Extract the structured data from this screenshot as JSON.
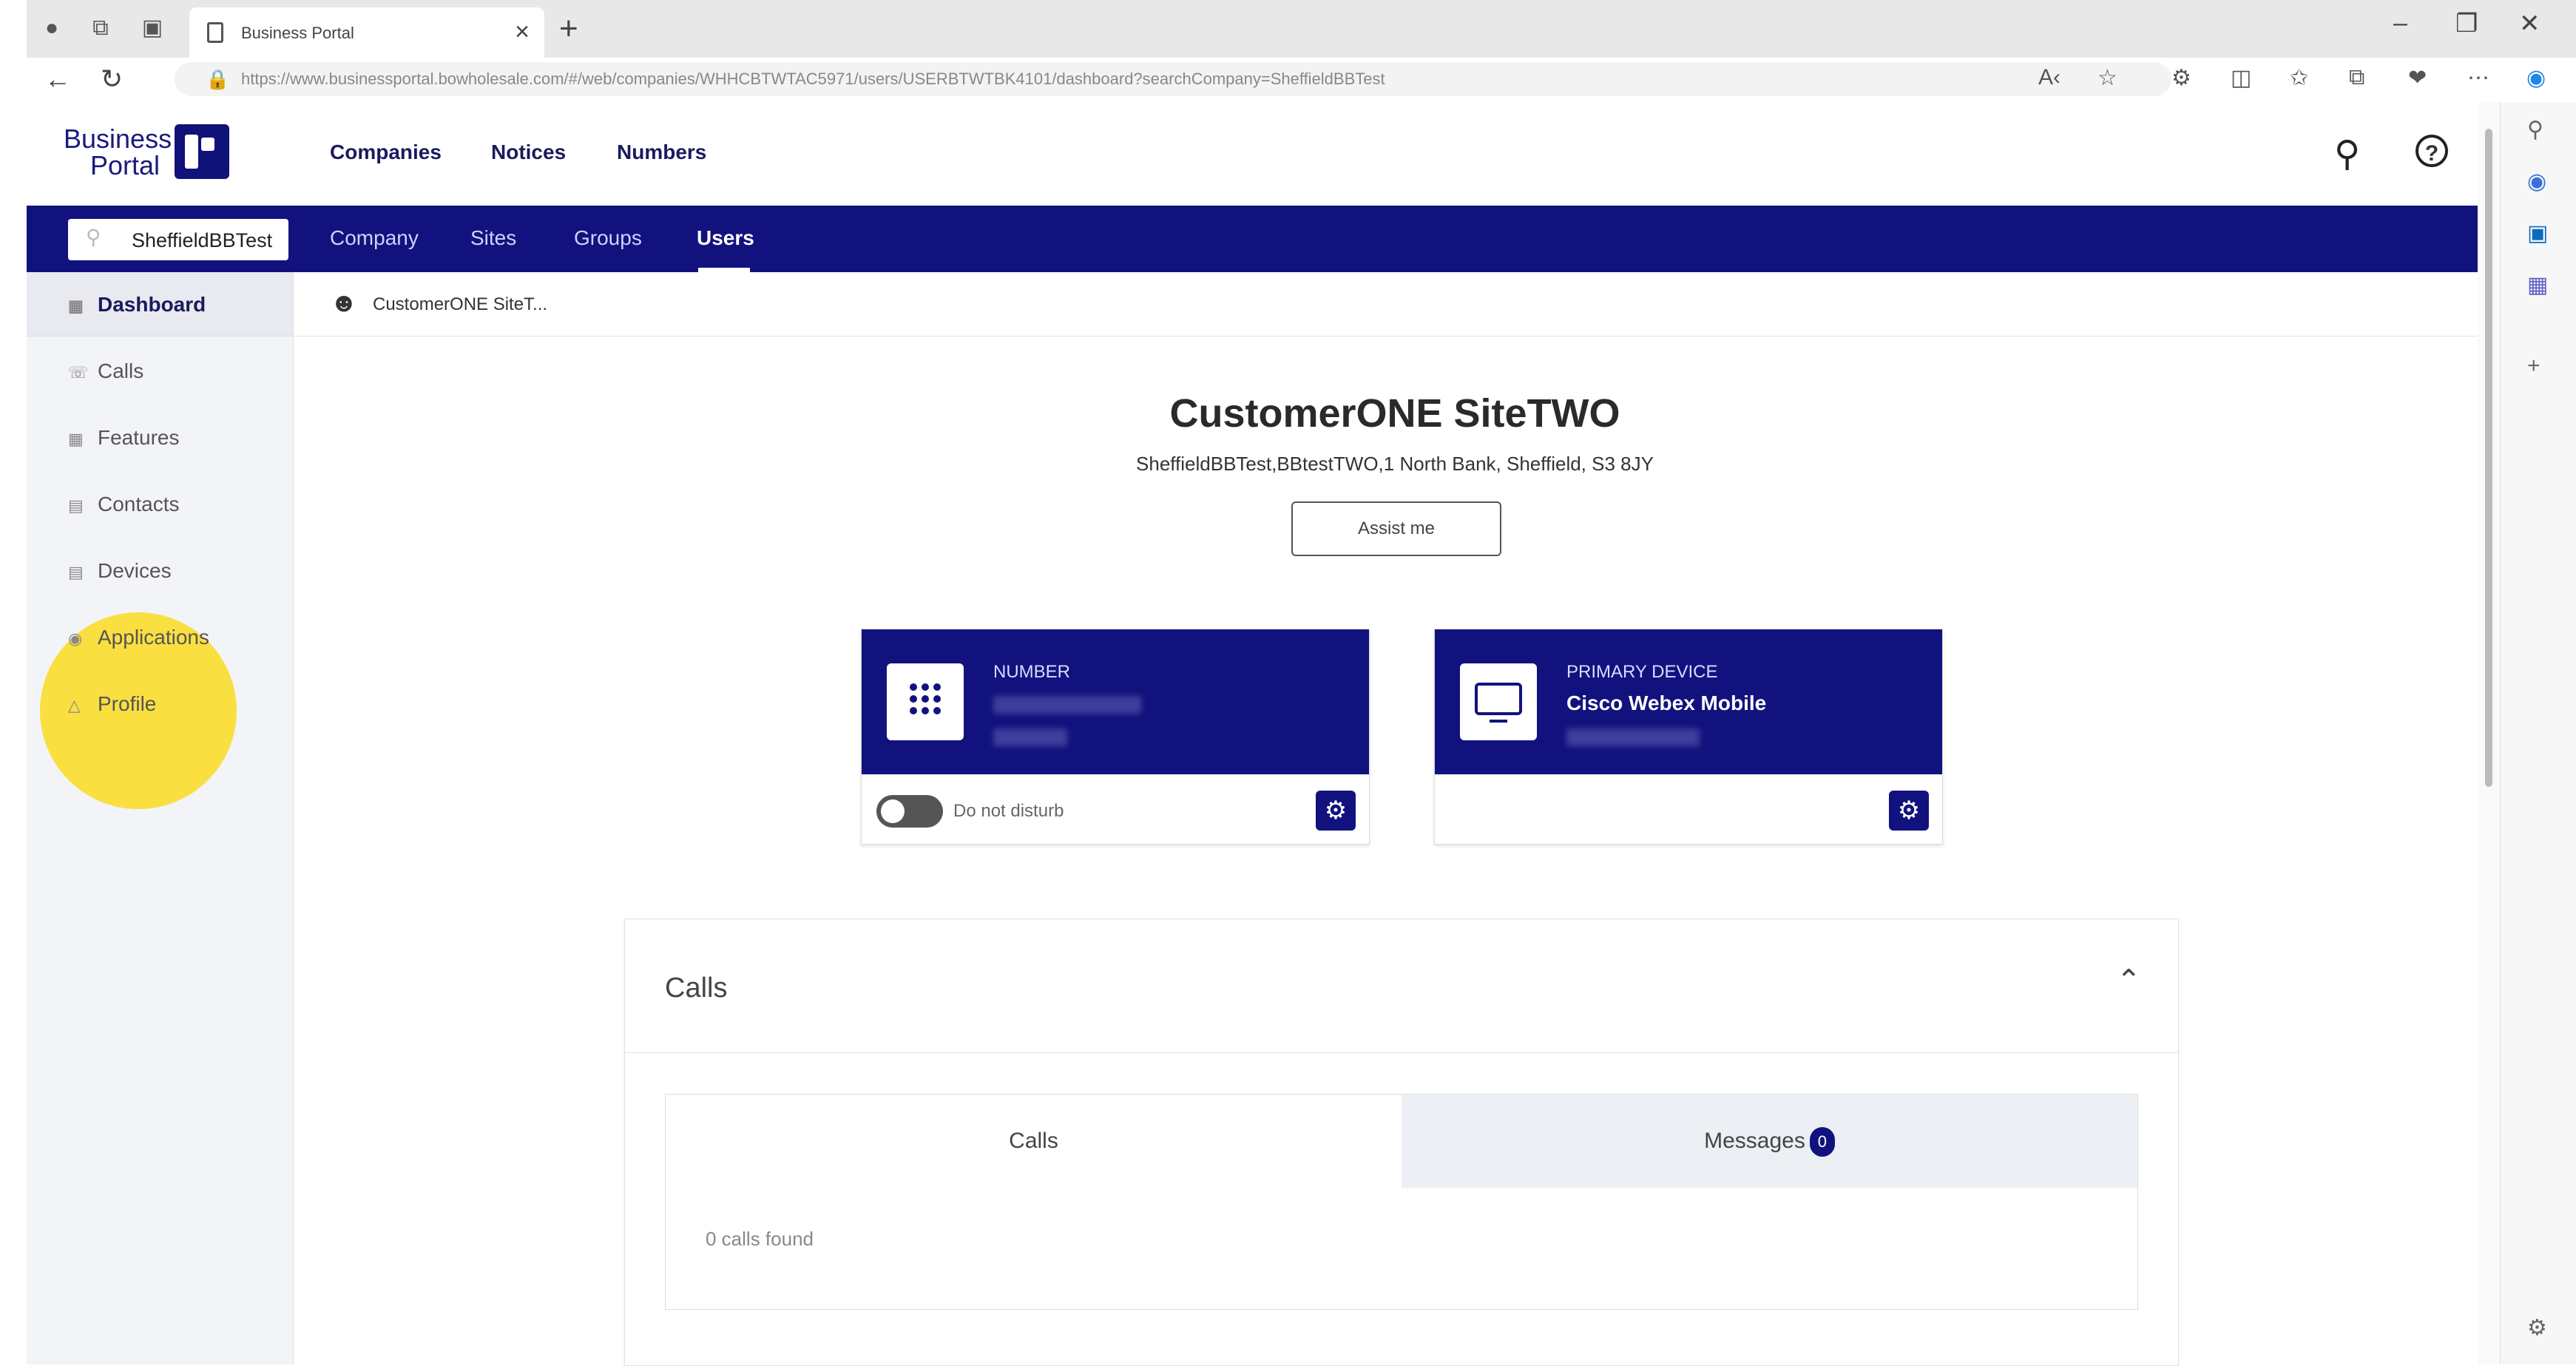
{
  "browser": {
    "tab_title": "Business Portal",
    "url": "https://www.businessportal.bowholesale.com/#/web/companies/WHHCBTWTAC5971/users/USERBTWTBK4101/dashboard?searchCompany=SheffieldBBTest",
    "new_tab": "+",
    "close_tab": "×"
  },
  "header": {
    "logo_text": "Business Portal",
    "nav": [
      "Companies",
      "Notices",
      "Numbers"
    ]
  },
  "subnav": {
    "search_value": "SheffieldBBTest",
    "items": [
      "Company",
      "Sites",
      "Groups",
      "Users"
    ],
    "active": "Users"
  },
  "sidebar": {
    "items": [
      {
        "label": "Dashboard",
        "icon": "grid-icon"
      },
      {
        "label": "Calls",
        "icon": "phone-icon"
      },
      {
        "label": "Features",
        "icon": "features-icon"
      },
      {
        "label": "Contacts",
        "icon": "contacts-icon"
      },
      {
        "label": "Devices",
        "icon": "devices-icon"
      },
      {
        "label": "Applications",
        "icon": "applications-icon"
      },
      {
        "label": "Profile",
        "icon": "profile-icon"
      }
    ]
  },
  "breadcrumb": {
    "user": "CustomerONE SiteT..."
  },
  "user": {
    "name": "CustomerONE SiteTWO",
    "address": "SheffieldBBTest,BBtestTWO,1 North Bank, Sheffield, S3 8JY",
    "assist_label": "Assist me"
  },
  "cards": {
    "number": {
      "label": "NUMBER",
      "dnd_label": "Do not disturb"
    },
    "device": {
      "label": "PRIMARY DEVICE",
      "value": "Cisco Webex Mobile"
    }
  },
  "calls_panel": {
    "title": "Calls",
    "tabs": [
      "Calls",
      "Messages"
    ],
    "messages_count": "0",
    "empty_text": "0 calls found"
  },
  "colors": {
    "brand": "#12127e",
    "highlight": "#fadc28"
  }
}
